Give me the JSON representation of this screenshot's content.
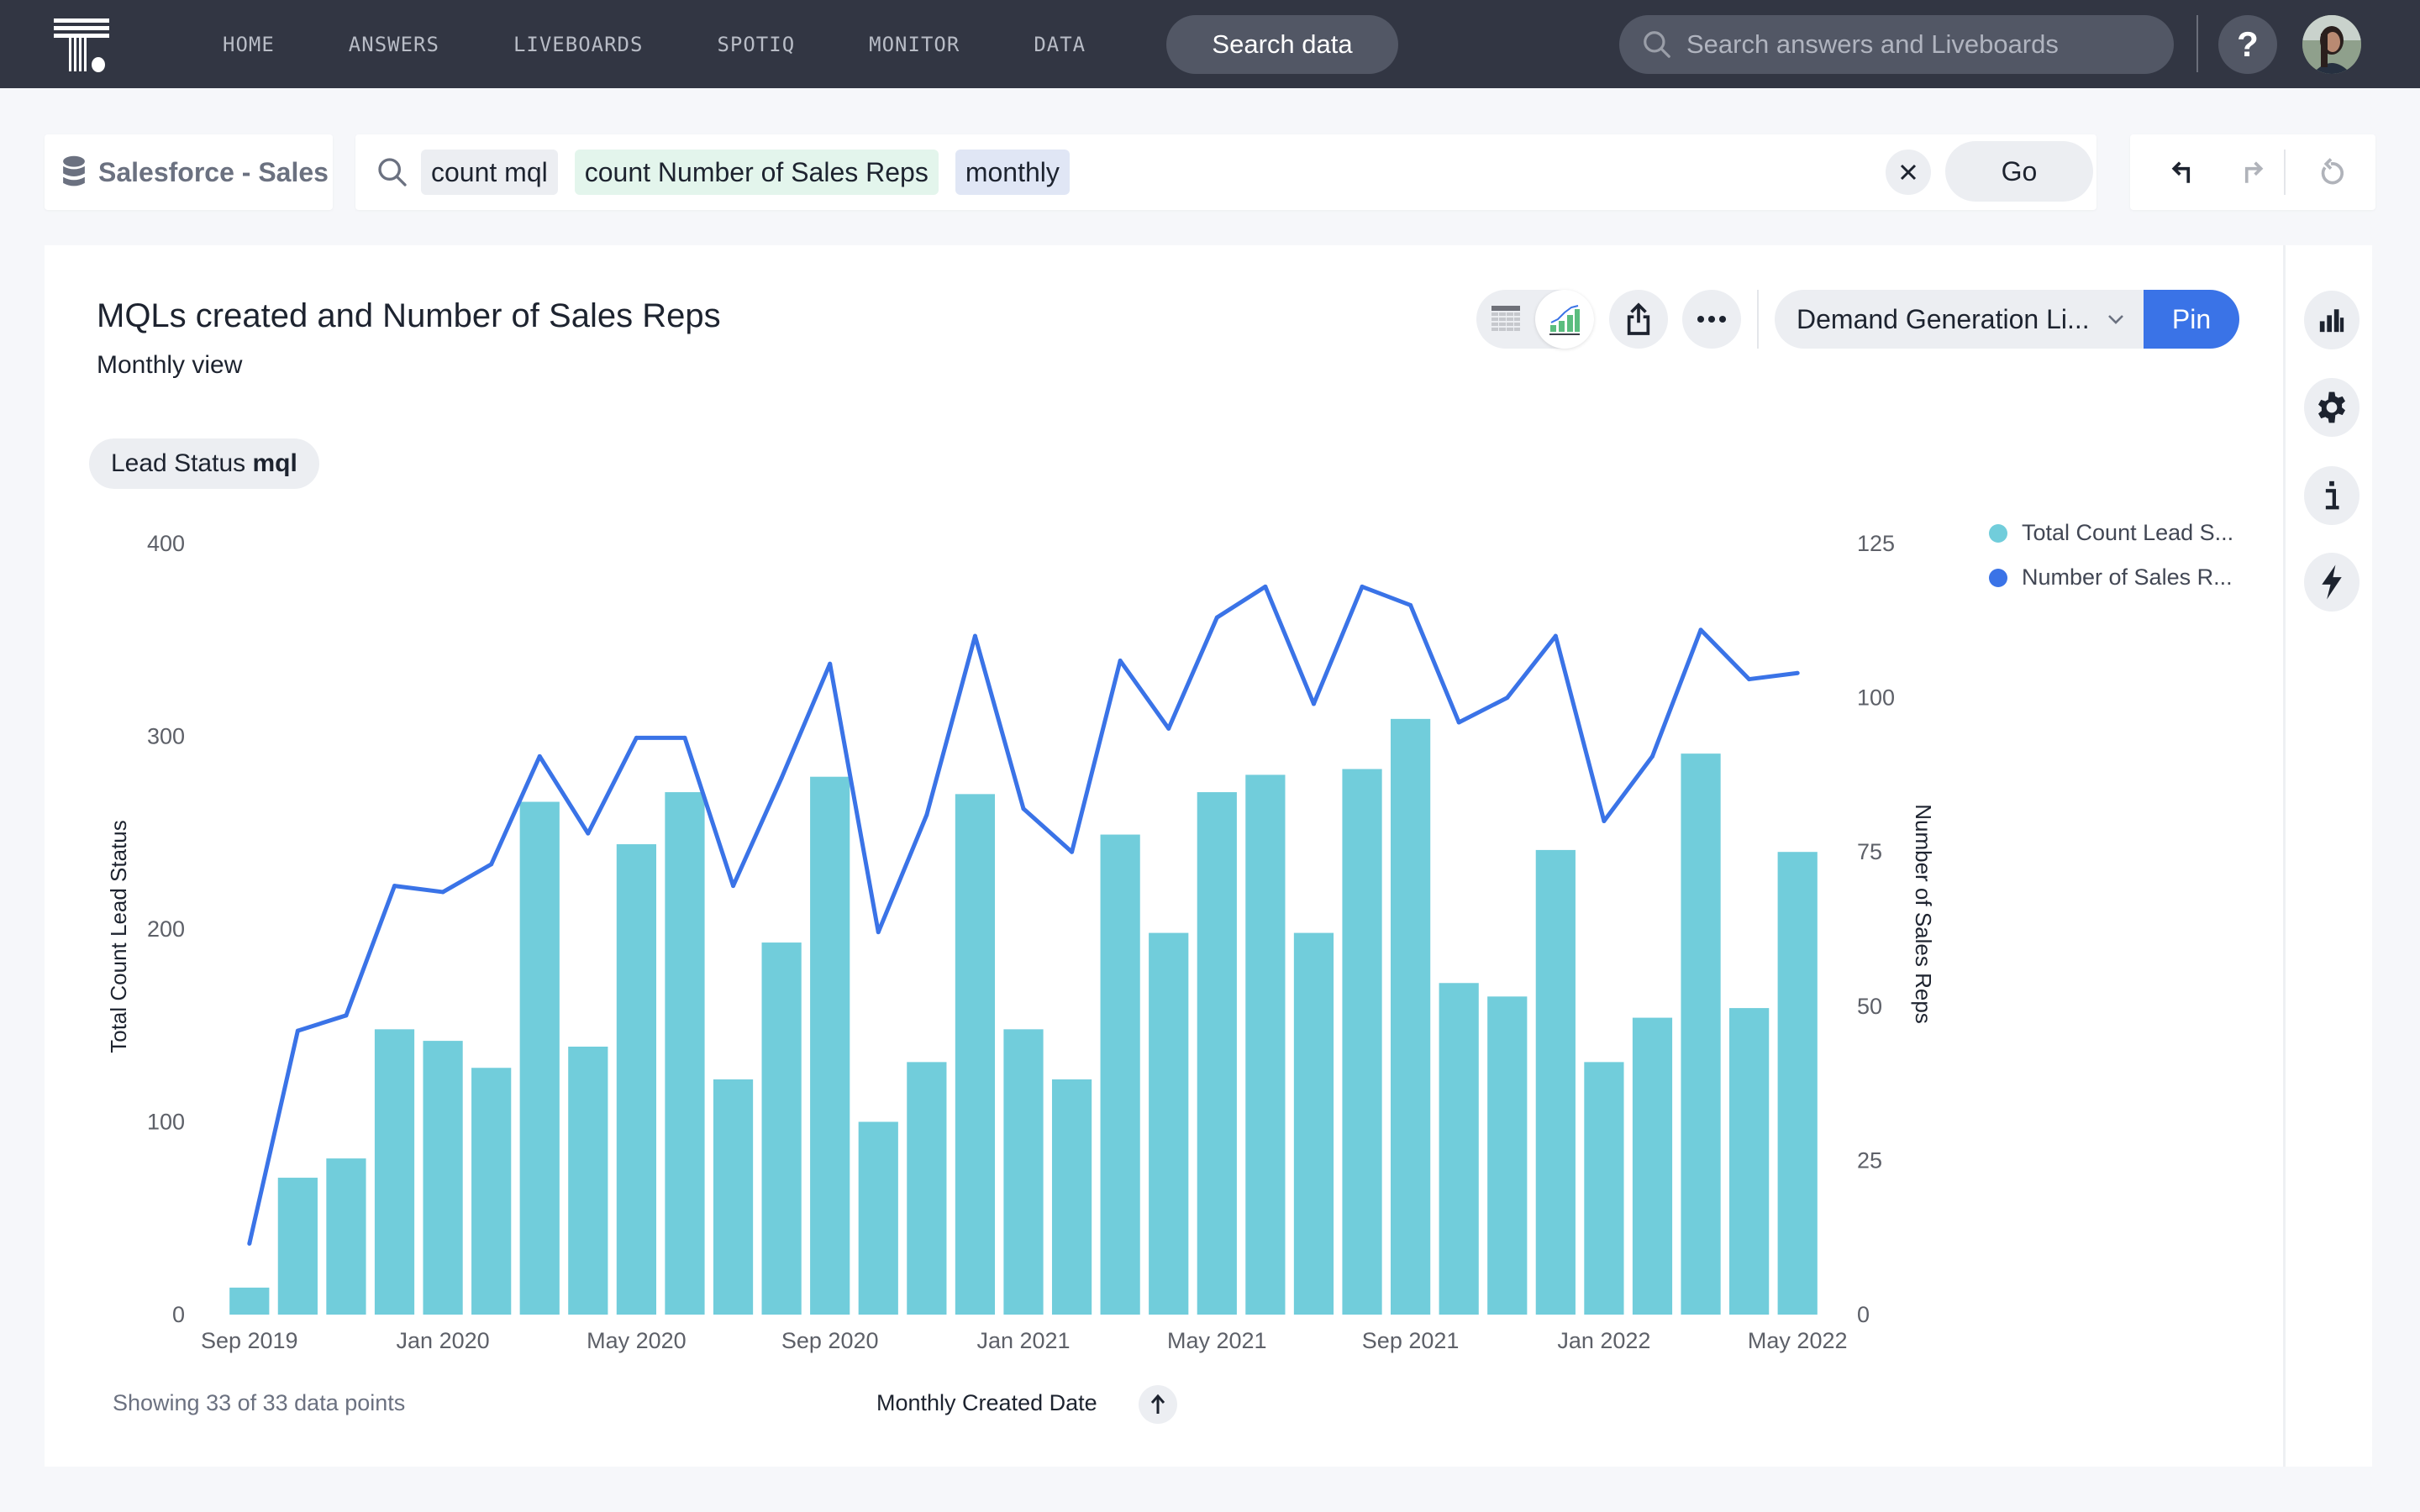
{
  "nav": {
    "links": [
      "HOME",
      "ANSWERS",
      "LIVEBOARDS",
      "SPOTIQ",
      "MONITOR",
      "DATA"
    ],
    "search_data_label": "Search data",
    "global_search_placeholder": "Search answers and Liveboards",
    "help_label": "?",
    "icons": {
      "logo": "thoughtspot-logo",
      "search": "search-icon",
      "help": "help-icon",
      "avatar": "user-avatar"
    }
  },
  "search_bar": {
    "source": "Salesforce - Sales",
    "tokens": [
      "count mql",
      "count Number of Sales Reps",
      "monthly"
    ],
    "go_label": "Go"
  },
  "answer": {
    "title": "MQLs created and Number of Sales Reps",
    "subtitle": "Monthly view",
    "filter_label": "Lead Status",
    "filter_value": "mql",
    "liveboard_select": "Demand Generation Li...",
    "pin_label": "Pin",
    "footer_count": "Showing 33 of 33 data points",
    "footer_axis": "Monthly Created Date"
  },
  "colors": {
    "bar": "#71cddb",
    "line": "#3a73e7",
    "nav_bg": "#323643",
    "accent": "#3a73e7"
  },
  "chart_data": {
    "type": "bar",
    "title": "MQLs created and Number of Sales Reps",
    "xlabel": "Monthly Created Date",
    "ylabel": "Total Count Lead Status",
    "y2label": "Number of Sales Reps",
    "ylim": [
      0,
      400
    ],
    "y2lim": [
      0,
      125
    ],
    "yticks": [
      "0",
      "100",
      "200",
      "300",
      "400"
    ],
    "y2ticks": [
      "0",
      "25",
      "50",
      "75",
      "100",
      "125"
    ],
    "grid": false,
    "legend_position": "top-right",
    "x_tick_labels": [
      "Sep 2019",
      "Jan 2020",
      "May 2020",
      "Sep 2020",
      "Jan 2021",
      "May 2021",
      "Sep 2021",
      "Jan 2022",
      "May 2022"
    ],
    "categories": [
      "Sep 2019",
      "Oct 2019",
      "Nov 2019",
      "Dec 2019",
      "Jan 2020",
      "Feb 2020",
      "Mar 2020",
      "Apr 2020",
      "May 2020",
      "Jun 2020",
      "Jul 2020",
      "Aug 2020",
      "Sep 2020",
      "Oct 2020",
      "Nov 2020",
      "Dec 2020",
      "Jan 2021",
      "Feb 2021",
      "Mar 2021",
      "Apr 2021",
      "May 2021",
      "Jun 2021",
      "Jul 2021",
      "Aug 2021",
      "Sep 2021",
      "Oct 2021",
      "Nov 2021",
      "Dec 2021",
      "Jan 2022",
      "Feb 2022",
      "Mar 2022",
      "Apr 2022",
      "May 2022"
    ],
    "series": [
      {
        "name": "Total Count Lead Status",
        "legend_label": "Total Count Lead S...",
        "type": "bar",
        "axis": "left",
        "values": [
          14,
          71,
          81,
          148,
          142,
          128,
          266,
          139,
          244,
          271,
          122,
          193,
          279,
          100,
          131,
          270,
          148,
          122,
          249,
          198,
          271,
          280,
          198,
          283,
          309,
          172,
          165,
          241,
          131,
          154,
          291,
          159,
          240
        ]
      },
      {
        "name": "Number of Sales Reps",
        "legend_label": "Number of Sales R...",
        "type": "line",
        "axis": "right",
        "values": [
          11.5,
          46,
          48.5,
          69.5,
          68.5,
          73,
          90.5,
          78,
          93.5,
          93.5,
          69.5,
          87,
          105.5,
          62,
          81,
          110,
          82,
          75,
          106,
          95,
          113,
          118,
          99,
          118,
          115,
          96,
          100,
          110,
          80,
          90.5,
          111,
          103,
          104
        ]
      }
    ]
  }
}
